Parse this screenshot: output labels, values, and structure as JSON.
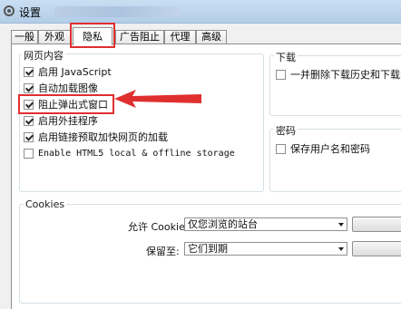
{
  "window": {
    "title": "设置"
  },
  "tabs": [
    {
      "label": "一般"
    },
    {
      "label": "外观"
    },
    {
      "label": "隐私"
    },
    {
      "label": "广告阻止"
    },
    {
      "label": "代理"
    },
    {
      "label": "高级"
    }
  ],
  "active_tab": "隐私",
  "web_content": {
    "title": "网页内容",
    "items": [
      {
        "label": "启用 JavaScript",
        "checked": true
      },
      {
        "label": "自动加载图像",
        "checked": true
      },
      {
        "label": "阻止弹出式窗口",
        "checked": true
      },
      {
        "label": "启用外挂程序",
        "checked": true
      },
      {
        "label": "启用链接预取加快网页的加载",
        "checked": true
      },
      {
        "label": "Enable HTML5 local & offline storage",
        "checked": false
      }
    ]
  },
  "download": {
    "title": "下载",
    "item": {
      "label": "一并删除下载历史和下载的文",
      "checked": false
    }
  },
  "password": {
    "title": "密码",
    "item": {
      "label": "保存用户名和密码",
      "checked": false
    }
  },
  "cookies": {
    "title": "Cookies",
    "allow_label": "允许 Cookies:",
    "allow_value": "仅您浏览的站台",
    "keep_label": "保留至:",
    "keep_value": "它们到期"
  },
  "colors": {
    "highlight": "#e02f2f"
  }
}
